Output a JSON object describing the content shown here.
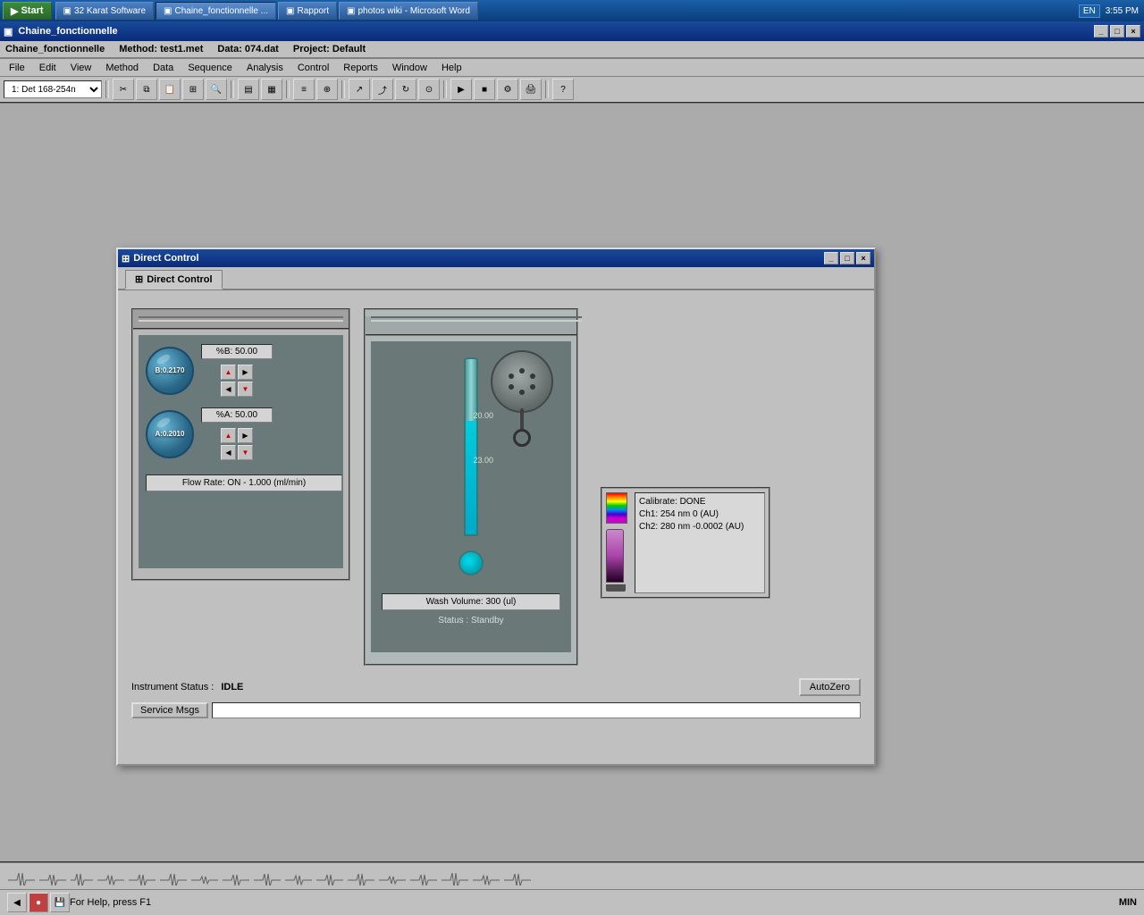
{
  "taskbar": {
    "start_label": "Start",
    "items": [
      {
        "label": "32 Karat Software",
        "active": false
      },
      {
        "label": "Chaine_fonctionnelle ...",
        "active": false
      },
      {
        "label": "Rapport",
        "active": false
      },
      {
        "label": "photos wiki - Microsoft Word",
        "active": false
      }
    ],
    "time": "3:55 PM",
    "lang": "EN"
  },
  "app": {
    "title": "Chaine_fonctionnelle",
    "method": "Method: test1.met",
    "data": "Data: 074.dat",
    "project": "Project: Default",
    "menus": [
      "File",
      "Edit",
      "View",
      "Method",
      "Data",
      "Sequence",
      "Analysis",
      "Control",
      "Reports",
      "Window",
      "Help"
    ],
    "toolbar_dropdown": "1: Det 168-254n"
  },
  "dialog": {
    "title": "Direct Control",
    "tab_label": "Direct Control",
    "tab_icon": "⊞",
    "pump_panel": {
      "channel_b": {
        "sphere_label": "B:0.2170",
        "input_label": "%B: 50.00"
      },
      "channel_a": {
        "sphere_label": "A:0.2010",
        "input_label": "%A: 50.00"
      },
      "flow_rate": "Flow Rate: ON - 1.000 (ml/min)"
    },
    "column_panel": {
      "wash_volume": "Wash Volume: 300 (ul)",
      "status": "Status : Standby",
      "temp_label_top": "23.00",
      "temp_label_bottom": "20.00"
    },
    "detector": {
      "calibrate": "Calibrate: DONE",
      "ch1": "Ch1:  254 nm  0 (AU)",
      "ch2": "Ch2:  280 nm  -0.0002 (AU)"
    },
    "instrument_status_label": "Instrument Status :",
    "instrument_status_value": "IDLE",
    "autozero_btn": "AutoZero",
    "service_btn": "Service Msgs"
  },
  "status_bar": {
    "help_text": "For Help, press F1",
    "min_label": "MIN"
  }
}
